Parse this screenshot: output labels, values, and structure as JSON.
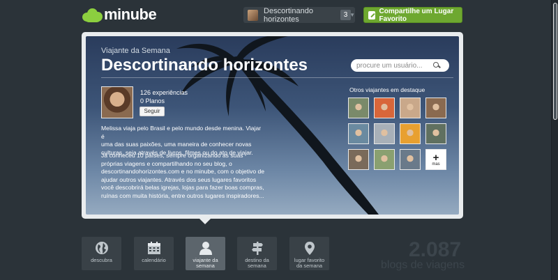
{
  "header": {
    "logo_text": "minube",
    "user_name": "Descortinando horizontes",
    "notification_count": "3",
    "share_button": "Compartilhe um Lugar Favorito"
  },
  "hero": {
    "subtitle": "Viajante da Semana",
    "title": "Descortinando horizontes",
    "search_placeholder": "procure um usuário...",
    "experiences": "126 experiências",
    "plans": "0 Planos",
    "follow_button": "Seguir",
    "bio_1": [
      "Melissa viaja pelo Brasil e pelo mundo desde menina. Viajar é",
      "uma das suas paixões, uma maneira de conhecer novas",
      "culturas, seja através de livros, filmes ou do ato de viajar."
    ],
    "bio_2": [
      "Já conheceu 10 países, sempre organizando as suas",
      "próprias viagens e compartilhando no seu blog, o",
      "descortinandohorizontes.com e no minube, com o objetivo de",
      "ajudar outros viajantes. Através dos seus lugares favoritos",
      "você descobrirá belas igrejas, lojas para fazer boas compras,",
      "ruínas com muita história, entre outros lugares inspiradores..."
    ],
    "others_title": "Otros viajantes em destaque",
    "more_label": "mas",
    "thumb_colors": [
      "#7a8a6a",
      "#d8663a",
      "#c9a88a",
      "#8a6a50",
      "#6a8aa0",
      "#a8b0b8",
      "#e8a030",
      "#607060",
      "#7a6a5a",
      "#8aa070",
      "#6a7a8a"
    ]
  },
  "nav": {
    "discover": "descubra",
    "calendar": "calendário",
    "traveler_1": "viajante da",
    "traveler_2": "semana",
    "destination_1": "destino da",
    "destination_2": "semana",
    "place_1": "lugar favorito",
    "place_2": "da semana"
  },
  "stats": {
    "blog_count": "2.087",
    "blog_caption": "blogs de viagens"
  },
  "colors": {
    "accent_green": "#6ea830",
    "background": "#2b3339"
  }
}
